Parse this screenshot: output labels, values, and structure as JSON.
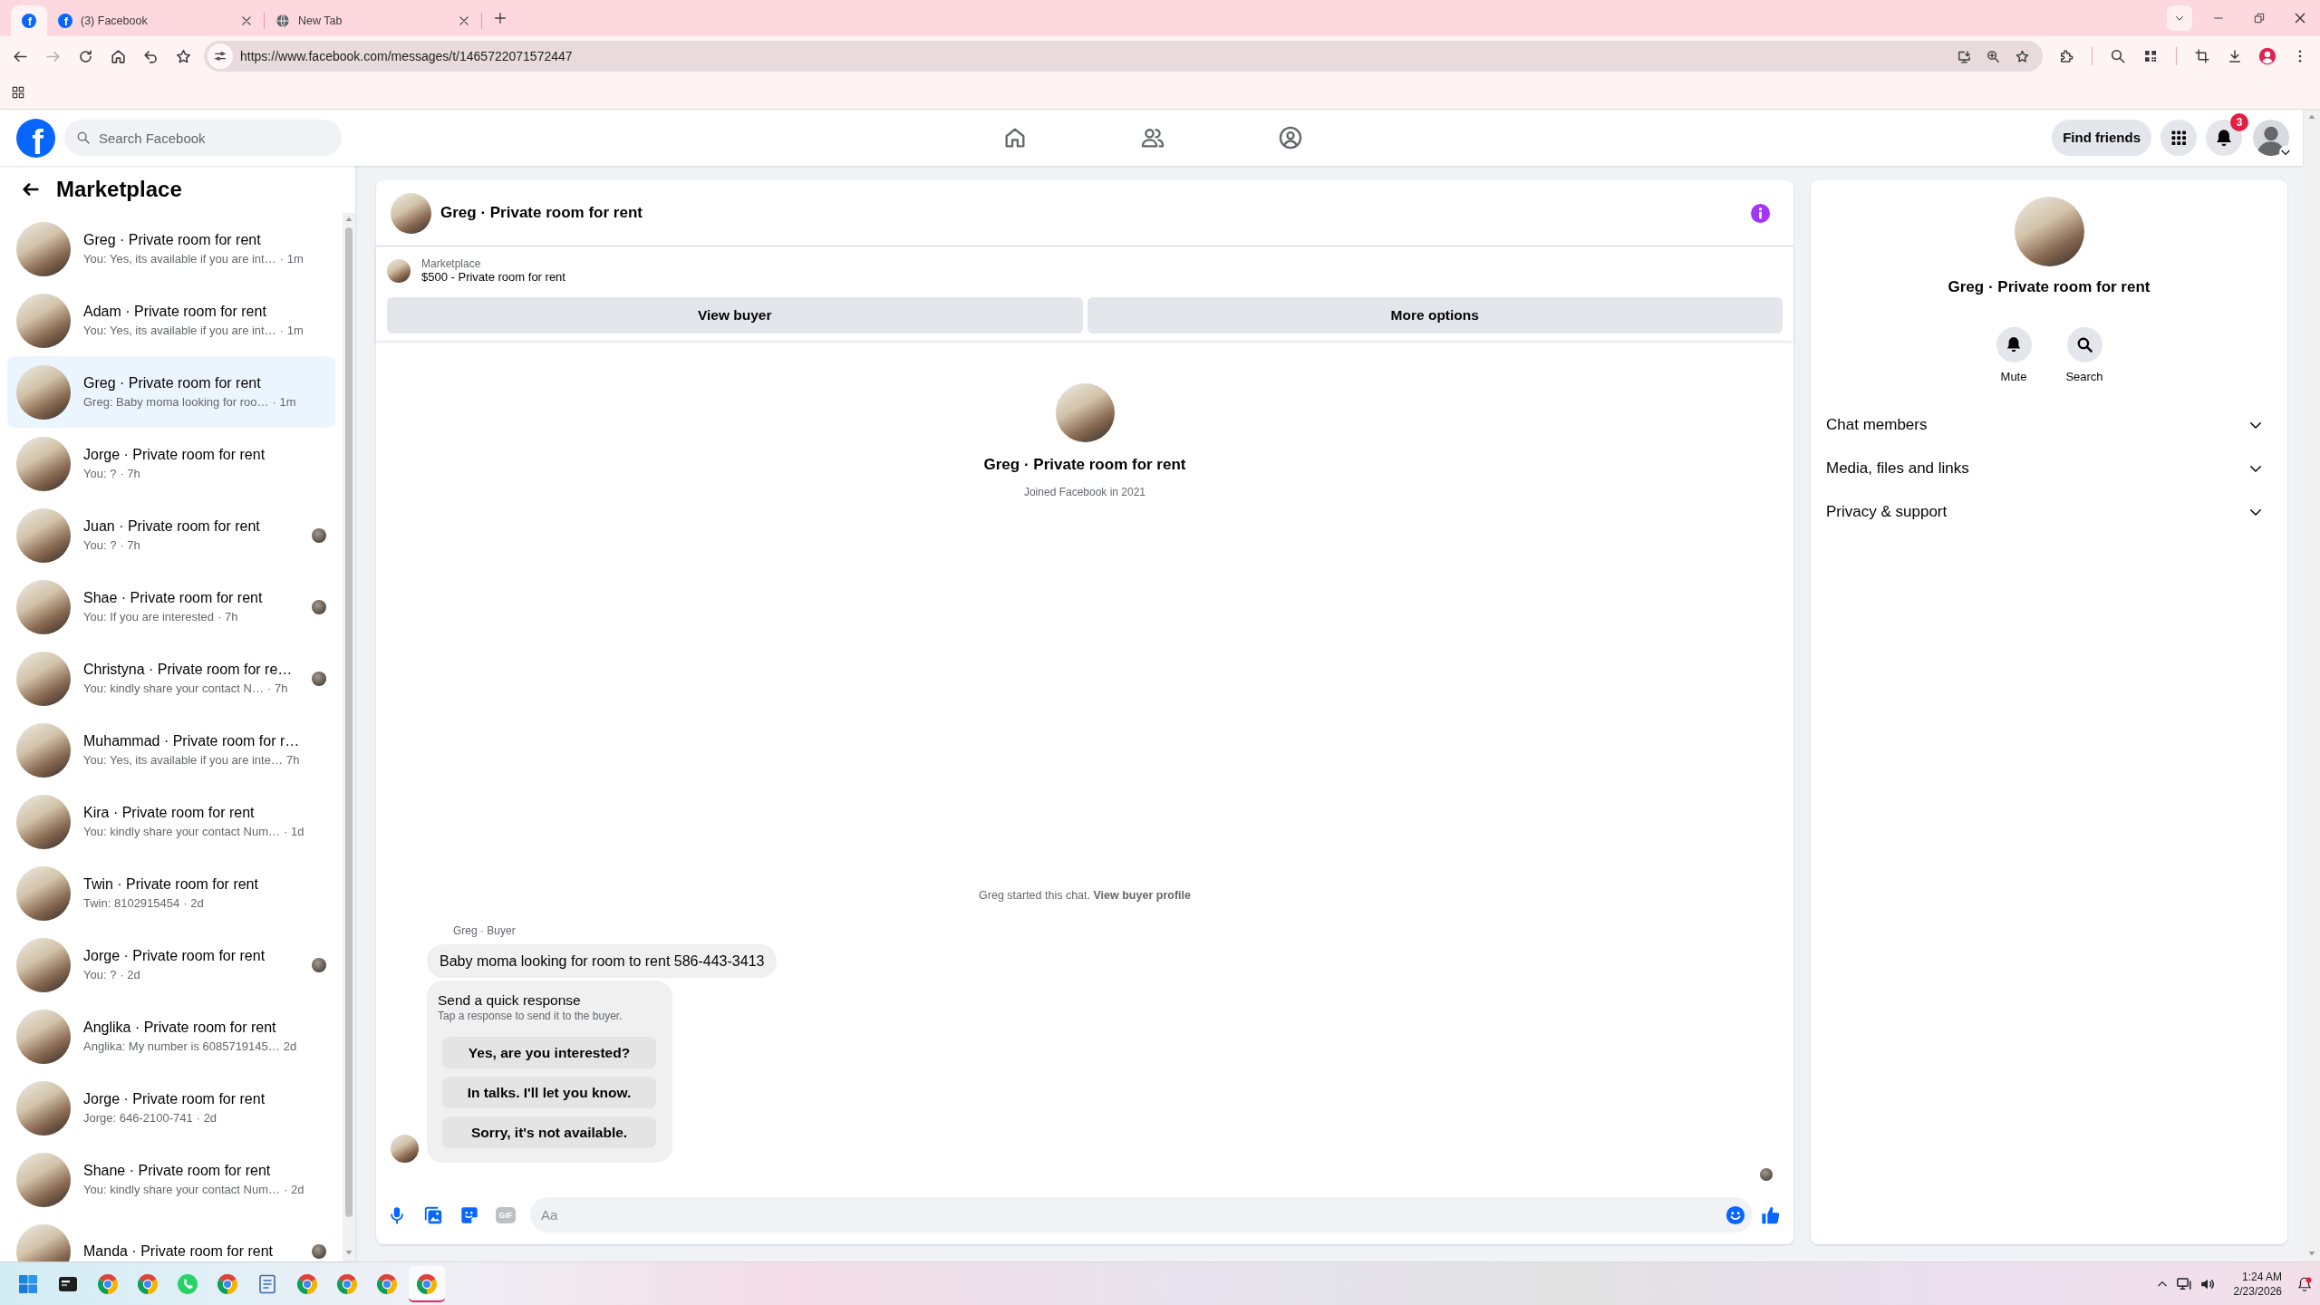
{
  "browser": {
    "tabs": [
      {
        "kind": "pinned",
        "favicon": "f",
        "selected": true
      },
      {
        "kind": "site",
        "favicon": "f",
        "title": "(3) Facebook",
        "selected": false
      },
      {
        "kind": "blank",
        "title": "New Tab",
        "selected": false
      }
    ],
    "forward_disabled": true,
    "url": "https://www.facebook.com/messages/t/1465722071572447"
  },
  "header": {
    "logo": "f",
    "search": {
      "placeholder": "Search Facebook"
    },
    "find_friends": "Find friends",
    "notification_count": "3"
  },
  "sidebar": {
    "title": "Marketplace",
    "conversations": [
      {
        "name": "Greg · Private room for rent",
        "preview": "You: Yes, its available if you are int…",
        "time": "· 1m",
        "seen": false,
        "selected": false
      },
      {
        "name": "Adam · Private room for rent",
        "preview": "You: Yes, its available if you are int…",
        "time": "· 1m",
        "seen": false,
        "selected": false
      },
      {
        "name": "Greg · Private room for rent",
        "preview": "Greg: Baby moma looking for roo…",
        "time": "· 1m",
        "seen": false,
        "selected": true
      },
      {
        "name": "Jorge · Private room for rent",
        "preview": "You: ?",
        "time": "· 7h",
        "seen": false,
        "selected": false
      },
      {
        "name": "Juan · Private room for rent",
        "preview": "You: ?",
        "time": "· 7h",
        "seen": true,
        "selected": false
      },
      {
        "name": "Shae · Private room for rent",
        "preview": "You: If you are interested",
        "time": "· 7h",
        "seen": true,
        "selected": false
      },
      {
        "name": "Christyna · Private room for re…",
        "preview": "You: kindly share your contact N…",
        "time": "· 7h",
        "seen": true,
        "selected": false
      },
      {
        "name": "Muhammad · Private room for r…",
        "preview": "You: Yes, its available if you are inte…",
        "time": "7h",
        "seen": false,
        "selected": false
      },
      {
        "name": "Kira · Private room for rent",
        "preview": "You: kindly share your contact Num…",
        "time": "· 1d",
        "seen": false,
        "selected": false
      },
      {
        "name": "Twin · Private room for rent",
        "preview": "Twin: 8102915454",
        "time": "· 2d",
        "seen": false,
        "selected": false
      },
      {
        "name": "Jorge · Private room for rent",
        "preview": "You: ?",
        "time": "· 2d",
        "seen": true,
        "selected": false
      },
      {
        "name": "Anglika · Private room for rent",
        "preview": "Anglika: My number is 6085719145…",
        "time": "2d",
        "seen": false,
        "selected": false
      },
      {
        "name": "Jorge · Private room for rent",
        "preview": "Jorge: 646-2100-741",
        "time": "· 2d",
        "seen": false,
        "selected": false
      },
      {
        "name": "Shane · Private room for rent",
        "preview": "You: kindly share your contact Num…",
        "time": "· 2d",
        "seen": false,
        "selected": false
      },
      {
        "name": "Manda · Private room for rent",
        "seen": true,
        "selected": false
      }
    ]
  },
  "chat": {
    "title": "Greg · Private room for rent",
    "listing": {
      "source": "Marketplace",
      "title": "$500 - Private room for rent"
    },
    "actions": [
      "View buyer",
      "More options"
    ],
    "intro": {
      "name": "Greg · Private room for rent",
      "joined": "Joined Facebook in 2021"
    },
    "note": {
      "text": "Greg started this chat.",
      "link": "View buyer profile"
    },
    "sender": "Greg · Buyer",
    "message": "Baby moma looking for room to rent 586-443-3413",
    "quick_response": {
      "title": "Send a quick response",
      "hint": "Tap a response to send it to the buyer.",
      "options": [
        "Yes, are you interested?",
        "In talks. I'll let you know.",
        "Sorry, it's not available."
      ]
    },
    "seen": true,
    "composer": {
      "gif": "GIF",
      "placeholder": "Aa"
    }
  },
  "details": {
    "name": "Greg · Private room for rent",
    "actions": [
      {
        "kind": "mute",
        "label": "Mute"
      },
      {
        "kind": "search",
        "label": "Search"
      }
    ],
    "sections": [
      {
        "label": "Chat members",
        "expanded": false
      },
      {
        "label": "Media, files and links",
        "expanded": false
      },
      {
        "label": "Privacy & support",
        "expanded": false
      }
    ]
  },
  "taskbar": {
    "apps": [
      {
        "kind": "start",
        "selected": false
      },
      {
        "kind": "app",
        "selected": false
      },
      {
        "kind": "browser",
        "selected": false
      },
      {
        "kind": "browser",
        "selected": false
      },
      {
        "kind": "chat",
        "selected": false
      },
      {
        "kind": "browser",
        "selected": false
      },
      {
        "kind": "notes",
        "selected": false
      },
      {
        "kind": "browser",
        "selected": false
      },
      {
        "kind": "browser",
        "selected": false
      },
      {
        "kind": "browser",
        "selected": false
      },
      {
        "kind": "browser",
        "selected": true
      }
    ],
    "time": "1:24 AM",
    "date": "2/23/2026"
  }
}
